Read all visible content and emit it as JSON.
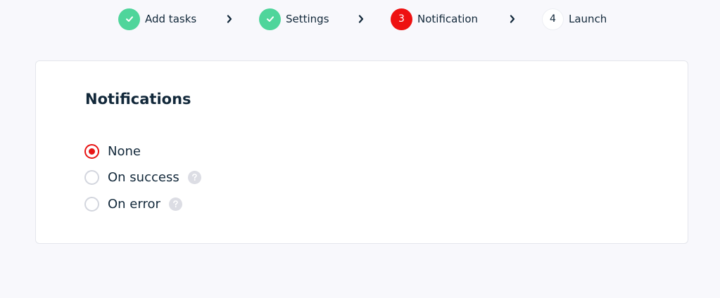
{
  "stepper": {
    "steps": [
      {
        "label": "Add tasks",
        "status": "done",
        "icon": "check-icon"
      },
      {
        "label": "Settings",
        "status": "done",
        "icon": "check-icon"
      },
      {
        "label": "Notification",
        "status": "active",
        "number": "3"
      },
      {
        "label": "Launch",
        "status": "pending",
        "number": "4"
      }
    ],
    "separator_icon": "chevron-right-icon"
  },
  "card": {
    "title": "Notifications",
    "options": [
      {
        "label": "None",
        "selected": true,
        "help": false
      },
      {
        "label": "On success",
        "selected": false,
        "help": true,
        "help_icon": "question-icon"
      },
      {
        "label": "On error",
        "selected": false,
        "help": true,
        "help_icon": "question-icon"
      }
    ]
  },
  "colors": {
    "done": "#4fd59b",
    "active": "#ee1111",
    "text": "#12283a",
    "background": "#f8f8fc"
  }
}
